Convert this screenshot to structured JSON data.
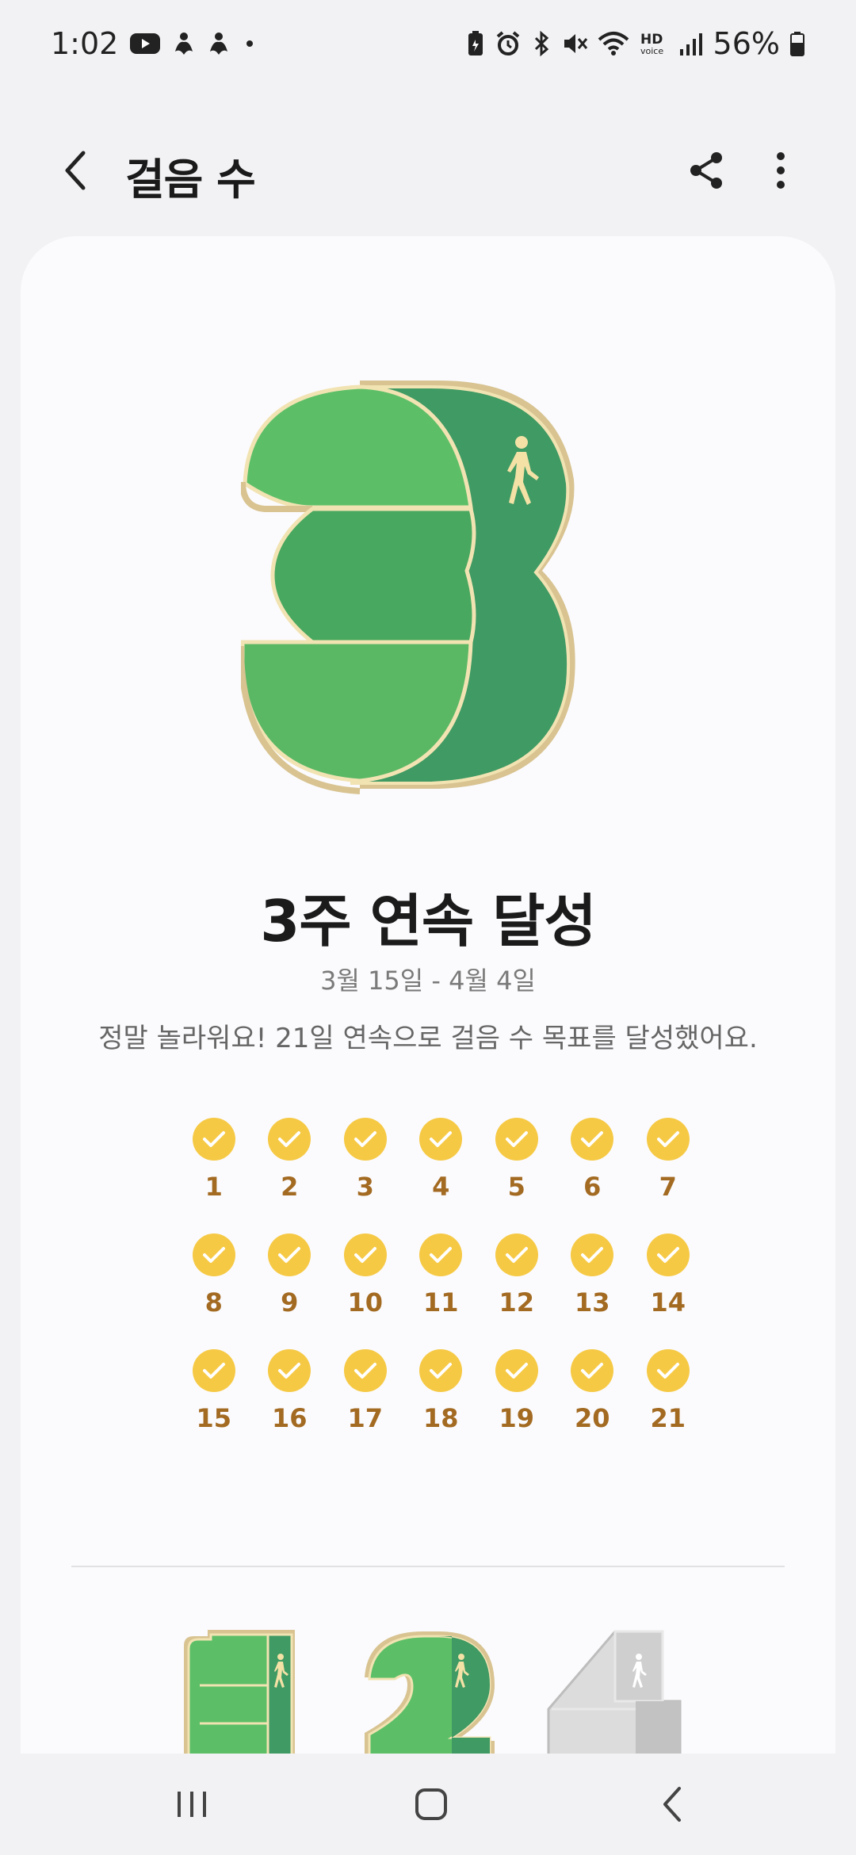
{
  "status_bar": {
    "time": "1:02",
    "battery_percent": "56%",
    "left_icons": [
      "youtube-icon",
      "samsung-health-icon",
      "samsung-health-icon",
      "dot-icon"
    ],
    "right_icons": [
      "battery-saver-icon",
      "alarm-icon",
      "bluetooth-icon",
      "mute-icon",
      "wifi-icon",
      "hd-voice-icon",
      "signal-icon",
      "battery-icon"
    ]
  },
  "app_bar": {
    "title": "걸음 수",
    "back_icon": "back-chevron-icon",
    "share_icon": "share-icon",
    "more_icon": "more-vertical-icon"
  },
  "achievement": {
    "badge_icon": "streak-3-badge-icon",
    "title": "3주 연속 달성",
    "date_range": "3월 15일 - 4월 4일",
    "message": "정말 놀라워요! 21일 연속으로 걸음 수 목표를 달성했어요."
  },
  "days": [
    "1",
    "2",
    "3",
    "4",
    "5",
    "6",
    "7",
    "8",
    "9",
    "10",
    "11",
    "12",
    "13",
    "14",
    "15",
    "16",
    "17",
    "18",
    "19",
    "20",
    "21"
  ],
  "colors": {
    "check_yellow": "#f6c945",
    "day_number": "#a36a22",
    "badge_green_light": "#5cbf67",
    "badge_green_dark": "#3f9a63",
    "badge_gold": "#e8d7a6",
    "locked_gray": "#c7c7c7"
  },
  "other_badges": [
    {
      "icon": "streak-1-badge-icon",
      "state": "earned"
    },
    {
      "icon": "streak-2-badge-icon",
      "state": "earned"
    },
    {
      "icon": "streak-4-badge-icon",
      "state": "locked"
    }
  ],
  "nav_bar": {
    "recents": "recents-icon",
    "home": "home-icon",
    "back": "back-icon"
  }
}
